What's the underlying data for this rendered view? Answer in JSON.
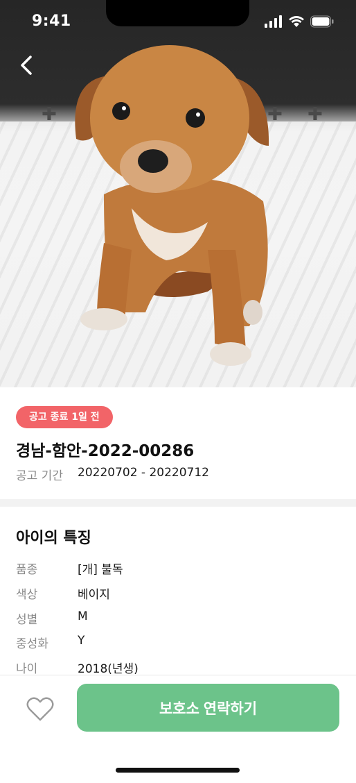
{
  "status_bar": {
    "time": "9:41"
  },
  "notice": {
    "badge": "공고 종료 1일 전",
    "id": "경남-함안-2022-00286",
    "period_label": "공고 기간",
    "period_value": "20220702 - 20220712"
  },
  "features": {
    "title": "아이의 특징",
    "rows": [
      {
        "label": "품종",
        "value": "[개] 불독"
      },
      {
        "label": "색상",
        "value": "베이지"
      },
      {
        "label": "성별",
        "value": "M"
      },
      {
        "label": "중성화",
        "value": "Y"
      },
      {
        "label": "나이",
        "value": "2018(년생)"
      }
    ]
  },
  "actions": {
    "contact_label": "보호소 연락하기"
  },
  "colors": {
    "badge": "#f26468",
    "primary_button": "#6cc38a"
  },
  "icons": {
    "back": "chevron-left-icon",
    "favorite": "heart-outline-icon",
    "signal": "signal-icon",
    "wifi": "wifi-icon",
    "battery": "battery-icon"
  }
}
